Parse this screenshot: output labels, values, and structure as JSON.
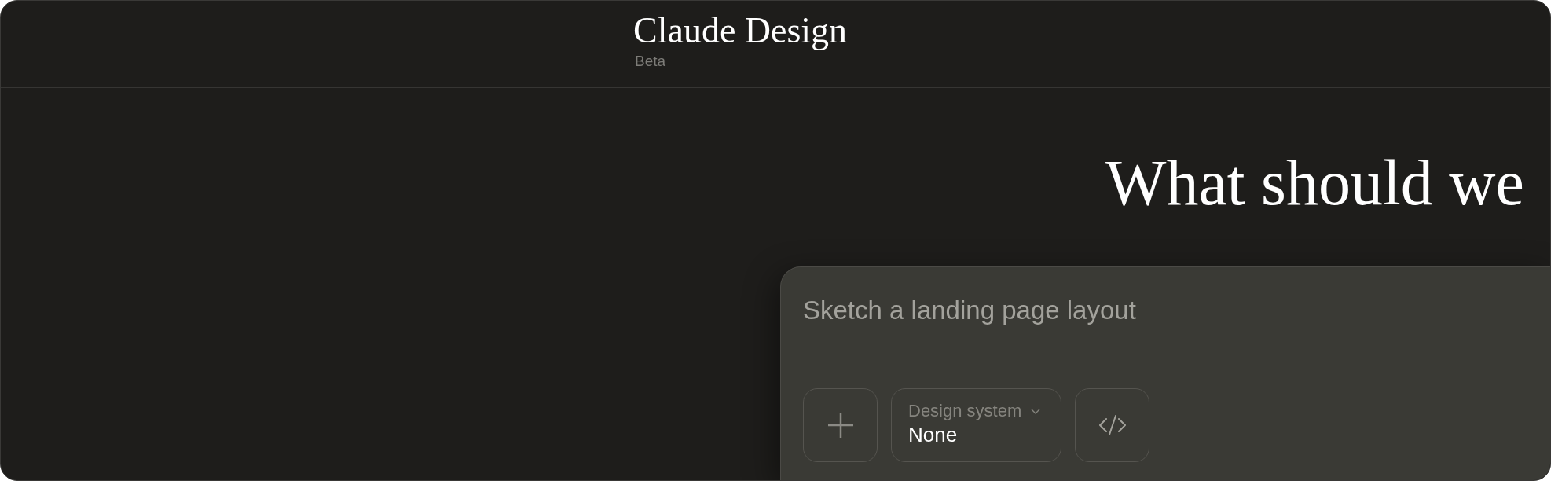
{
  "header": {
    "title": "Claude Design",
    "badge": "Beta"
  },
  "heading": "What should we",
  "prompt": {
    "placeholder": "Sketch a landing page layout"
  },
  "design_system": {
    "label": "Design system",
    "value": "None"
  }
}
